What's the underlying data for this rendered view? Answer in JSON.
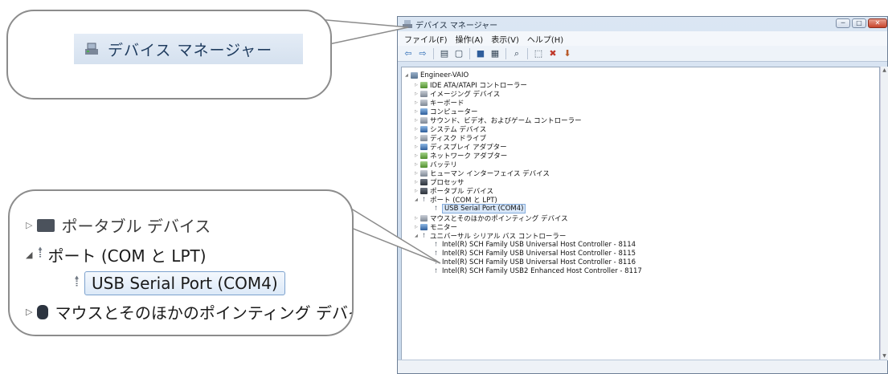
{
  "window": {
    "title": "デバイス マネージャー",
    "controls": [
      "─",
      "□",
      "✕"
    ]
  },
  "menu": [
    "ファイル(F)",
    "操作(A)",
    "表示(V)",
    "ヘルプ(H)"
  ],
  "toolbar_icons": [
    "back-icon",
    "forward-icon",
    "console-tree-icon",
    "properties-icon",
    "help-icon",
    "view-icon",
    "scan-icon",
    "update-driver-icon",
    "uninstall-icon",
    "disable-icon"
  ],
  "tree": {
    "root": "Engineer-VAIO",
    "items": [
      "IDE ATA/ATAPI コントローラー",
      "イメージング デバイス",
      "キーボード",
      "コンピューター",
      "サウンド、ビデオ、およびゲーム コントローラー",
      "システム デバイス",
      "ディスク ドライブ",
      "ディスプレイ アダプター",
      "ネットワーク アダプター",
      "バッテリ",
      "ヒューマン インターフェイス デバイス",
      "プロセッサ",
      "ポータブル デバイス",
      "ポート (COM と LPT)",
      "USB Serial Port (COM4)",
      "マウスとそのほかのポインティング デバイス",
      "モニター",
      "ユニバーサル シリアル バス コントローラー",
      "Intel(R) SCH Family USB Universal Host Controller - 8114",
      "Intel(R) SCH Family USB Universal Host Controller - 8115",
      "Intel(R) SCH Family USB Universal Host Controller - 8116",
      "Intel(R) SCH Family USB2 Enhanced Host Controller - 8117"
    ]
  },
  "callout_top": {
    "title": "デバイス マネージャー"
  },
  "callout_bottom": {
    "clipped_top": "ポータブル デバイス",
    "port_group": "ポート (COM と LPT)",
    "selected_port": "USB Serial Port (COM4)",
    "clipped_bottom": "マウスとそのほかのポインティング デバイス"
  }
}
